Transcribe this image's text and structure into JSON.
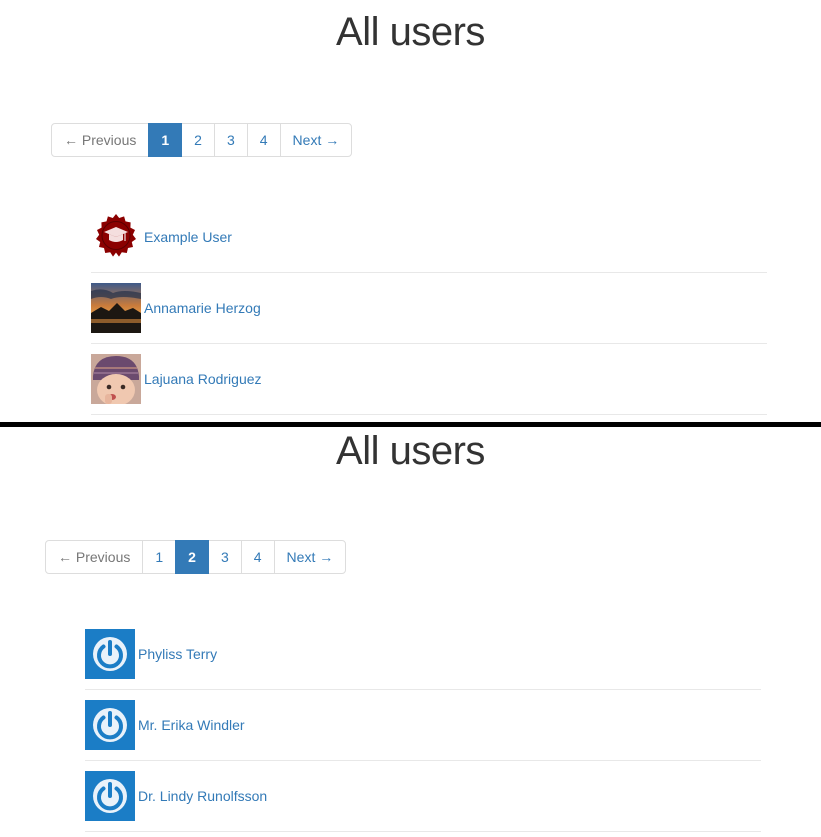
{
  "panels": [
    {
      "title": "All users",
      "pagination": {
        "previous": "← Previous",
        "pages": [
          "1",
          "2",
          "3",
          "4"
        ],
        "active": "1",
        "next": "Next →"
      },
      "users": [
        {
          "name": "Example User",
          "avatar": "red-seal-graduation-cap"
        },
        {
          "name": "Annamarie Herzog",
          "avatar": "sunset-photo"
        },
        {
          "name": "Lajuana Rodriguez",
          "avatar": "child-in-knit-hat-photo"
        }
      ]
    },
    {
      "title": "All users",
      "pagination": {
        "previous": "← Previous",
        "pages": [
          "1",
          "2",
          "3",
          "4"
        ],
        "active": "2",
        "next": "Next →"
      },
      "users": [
        {
          "name": "Phyliss Terry",
          "avatar": "default-power-icon"
        },
        {
          "name": "Mr. Erika Windler",
          "avatar": "default-power-icon"
        },
        {
          "name": "Dr. Lindy Runolfsson",
          "avatar": "default-power-icon"
        }
      ]
    }
  ],
  "colors": {
    "link": "#337ab7",
    "active_page_bg": "#337ab7",
    "disabled_text": "#777777",
    "default_avatar_bg": "#1b7dc6",
    "seal_red": "#8b0000",
    "divider": "#000000"
  }
}
